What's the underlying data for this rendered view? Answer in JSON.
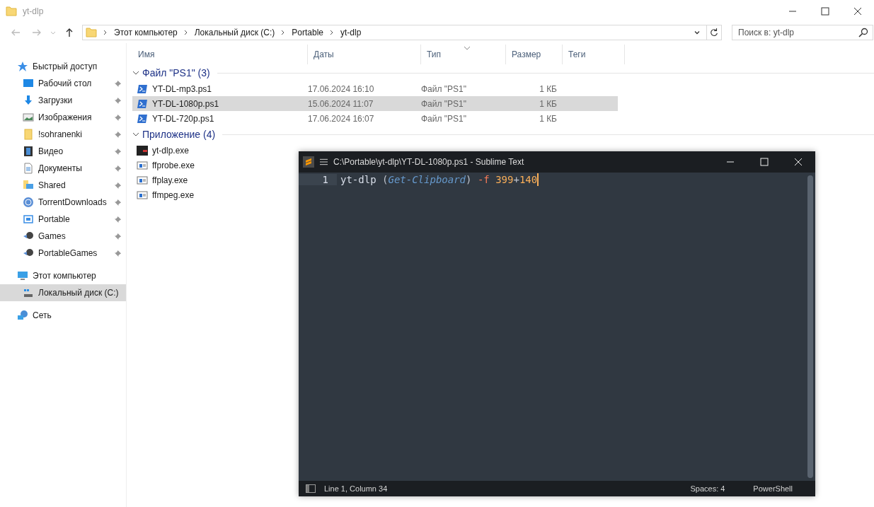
{
  "explorer": {
    "title": "yt-dlp",
    "breadcrumbs": [
      "Этот компьютер",
      "Локальный диск (C:)",
      "Portable",
      "yt-dlp"
    ],
    "search": {
      "placeholder": "Поиск в: yt-dlp"
    },
    "columns": [
      "Имя",
      "Даты",
      "Тип",
      "Размер",
      "Теги"
    ],
    "sidebar": [
      {
        "label": "Быстрый доступ",
        "selected": false,
        "children": [
          {
            "label": "Рабочий стол",
            "pinned": true,
            "selected": false
          },
          {
            "label": "Загрузки",
            "pinned": true,
            "selected": false
          },
          {
            "label": "Изображения",
            "pinned": true,
            "selected": false
          },
          {
            "label": "!sohranenki",
            "pinned": true,
            "selected": false
          },
          {
            "label": "Видео",
            "pinned": true,
            "selected": false
          },
          {
            "label": "Документы",
            "pinned": true,
            "selected": false
          },
          {
            "label": "Shared",
            "pinned": true,
            "selected": false
          },
          {
            "label": "TorrentDownloads",
            "pinned": true,
            "selected": false
          },
          {
            "label": "Portable",
            "pinned": true,
            "selected": false
          },
          {
            "label": "Games",
            "pinned": true,
            "selected": false
          },
          {
            "label": "PortableGames",
            "pinned": true,
            "selected": false
          }
        ]
      },
      {
        "label": "Этот компьютер",
        "selected": false,
        "children": [
          {
            "label": "Локальный диск (C:)",
            "pinned": false,
            "selected": true
          }
        ]
      },
      {
        "label": "Сеть",
        "selected": false
      }
    ],
    "groups": [
      {
        "title": "Файл \"PS1\" (3)",
        "expanded": true,
        "rows": [
          {
            "name": "YT-DL-mp3.ps1",
            "date": "17.06.2024 16:10",
            "type": "Файл \"PS1\"",
            "size": "1 КБ",
            "kind": "script",
            "selected": false
          },
          {
            "name": "YT-DL-1080p.ps1",
            "date": "15.06.2024 11:07",
            "type": "Файл \"PS1\"",
            "size": "1 КБ",
            "kind": "script",
            "selected": true
          },
          {
            "name": "YT-DL-720p.ps1",
            "date": "17.06.2024 16:07",
            "type": "Файл \"PS1\"",
            "size": "1 КБ",
            "kind": "script",
            "selected": false
          }
        ]
      },
      {
        "title": "Приложение (4)",
        "expanded": true,
        "rows": [
          {
            "name": "yt-dlp.exe",
            "kind": "console",
            "selected": false
          },
          {
            "name": "ffprobe.exe",
            "kind": "app",
            "selected": false
          },
          {
            "name": "ffplay.exe",
            "kind": "app",
            "selected": false
          },
          {
            "name": "ffmpeg.exe",
            "kind": "app",
            "selected": false
          }
        ]
      }
    ]
  },
  "editor": {
    "title": "C:\\Portable\\yt-dlp\\YT-DL-1080p.ps1 - Sublime Text",
    "lines": [
      {
        "number": "1",
        "tokens": [
          {
            "text": "yt-dlp ",
            "kind": "plain"
          },
          {
            "text": "(",
            "kind": "paren"
          },
          {
            "text": "Get-Clipboard",
            "kind": "func"
          },
          {
            "text": ") ",
            "kind": "paren"
          },
          {
            "text": "-f ",
            "kind": "flag"
          },
          {
            "text": "399",
            "kind": "number"
          },
          {
            "text": "+",
            "kind": "operator"
          },
          {
            "text": "140",
            "kind": "number"
          }
        ]
      }
    ],
    "status": {
      "position": "Line 1, Column 34",
      "indent": "Spaces: 4",
      "syntax": "PowerShell"
    }
  }
}
